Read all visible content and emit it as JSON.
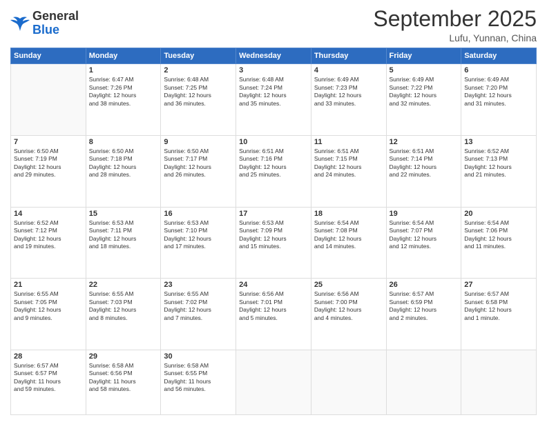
{
  "header": {
    "logo_general": "General",
    "logo_blue": "Blue",
    "month": "September 2025",
    "location": "Lufu, Yunnan, China"
  },
  "weekdays": [
    "Sunday",
    "Monday",
    "Tuesday",
    "Wednesday",
    "Thursday",
    "Friday",
    "Saturday"
  ],
  "weeks": [
    [
      {
        "day": "",
        "text": ""
      },
      {
        "day": "1",
        "text": "Sunrise: 6:47 AM\nSunset: 7:26 PM\nDaylight: 12 hours\nand 38 minutes."
      },
      {
        "day": "2",
        "text": "Sunrise: 6:48 AM\nSunset: 7:25 PM\nDaylight: 12 hours\nand 36 minutes."
      },
      {
        "day": "3",
        "text": "Sunrise: 6:48 AM\nSunset: 7:24 PM\nDaylight: 12 hours\nand 35 minutes."
      },
      {
        "day": "4",
        "text": "Sunrise: 6:49 AM\nSunset: 7:23 PM\nDaylight: 12 hours\nand 33 minutes."
      },
      {
        "day": "5",
        "text": "Sunrise: 6:49 AM\nSunset: 7:22 PM\nDaylight: 12 hours\nand 32 minutes."
      },
      {
        "day": "6",
        "text": "Sunrise: 6:49 AM\nSunset: 7:20 PM\nDaylight: 12 hours\nand 31 minutes."
      }
    ],
    [
      {
        "day": "7",
        "text": "Sunrise: 6:50 AM\nSunset: 7:19 PM\nDaylight: 12 hours\nand 29 minutes."
      },
      {
        "day": "8",
        "text": "Sunrise: 6:50 AM\nSunset: 7:18 PM\nDaylight: 12 hours\nand 28 minutes."
      },
      {
        "day": "9",
        "text": "Sunrise: 6:50 AM\nSunset: 7:17 PM\nDaylight: 12 hours\nand 26 minutes."
      },
      {
        "day": "10",
        "text": "Sunrise: 6:51 AM\nSunset: 7:16 PM\nDaylight: 12 hours\nand 25 minutes."
      },
      {
        "day": "11",
        "text": "Sunrise: 6:51 AM\nSunset: 7:15 PM\nDaylight: 12 hours\nand 24 minutes."
      },
      {
        "day": "12",
        "text": "Sunrise: 6:51 AM\nSunset: 7:14 PM\nDaylight: 12 hours\nand 22 minutes."
      },
      {
        "day": "13",
        "text": "Sunrise: 6:52 AM\nSunset: 7:13 PM\nDaylight: 12 hours\nand 21 minutes."
      }
    ],
    [
      {
        "day": "14",
        "text": "Sunrise: 6:52 AM\nSunset: 7:12 PM\nDaylight: 12 hours\nand 19 minutes."
      },
      {
        "day": "15",
        "text": "Sunrise: 6:53 AM\nSunset: 7:11 PM\nDaylight: 12 hours\nand 18 minutes."
      },
      {
        "day": "16",
        "text": "Sunrise: 6:53 AM\nSunset: 7:10 PM\nDaylight: 12 hours\nand 17 minutes."
      },
      {
        "day": "17",
        "text": "Sunrise: 6:53 AM\nSunset: 7:09 PM\nDaylight: 12 hours\nand 15 minutes."
      },
      {
        "day": "18",
        "text": "Sunrise: 6:54 AM\nSunset: 7:08 PM\nDaylight: 12 hours\nand 14 minutes."
      },
      {
        "day": "19",
        "text": "Sunrise: 6:54 AM\nSunset: 7:07 PM\nDaylight: 12 hours\nand 12 minutes."
      },
      {
        "day": "20",
        "text": "Sunrise: 6:54 AM\nSunset: 7:06 PM\nDaylight: 12 hours\nand 11 minutes."
      }
    ],
    [
      {
        "day": "21",
        "text": "Sunrise: 6:55 AM\nSunset: 7:05 PM\nDaylight: 12 hours\nand 9 minutes."
      },
      {
        "day": "22",
        "text": "Sunrise: 6:55 AM\nSunset: 7:03 PM\nDaylight: 12 hours\nand 8 minutes."
      },
      {
        "day": "23",
        "text": "Sunrise: 6:55 AM\nSunset: 7:02 PM\nDaylight: 12 hours\nand 7 minutes."
      },
      {
        "day": "24",
        "text": "Sunrise: 6:56 AM\nSunset: 7:01 PM\nDaylight: 12 hours\nand 5 minutes."
      },
      {
        "day": "25",
        "text": "Sunrise: 6:56 AM\nSunset: 7:00 PM\nDaylight: 12 hours\nand 4 minutes."
      },
      {
        "day": "26",
        "text": "Sunrise: 6:57 AM\nSunset: 6:59 PM\nDaylight: 12 hours\nand 2 minutes."
      },
      {
        "day": "27",
        "text": "Sunrise: 6:57 AM\nSunset: 6:58 PM\nDaylight: 12 hours\nand 1 minute."
      }
    ],
    [
      {
        "day": "28",
        "text": "Sunrise: 6:57 AM\nSunset: 6:57 PM\nDaylight: 11 hours\nand 59 minutes."
      },
      {
        "day": "29",
        "text": "Sunrise: 6:58 AM\nSunset: 6:56 PM\nDaylight: 11 hours\nand 58 minutes."
      },
      {
        "day": "30",
        "text": "Sunrise: 6:58 AM\nSunset: 6:55 PM\nDaylight: 11 hours\nand 56 minutes."
      },
      {
        "day": "",
        "text": ""
      },
      {
        "day": "",
        "text": ""
      },
      {
        "day": "",
        "text": ""
      },
      {
        "day": "",
        "text": ""
      }
    ]
  ]
}
